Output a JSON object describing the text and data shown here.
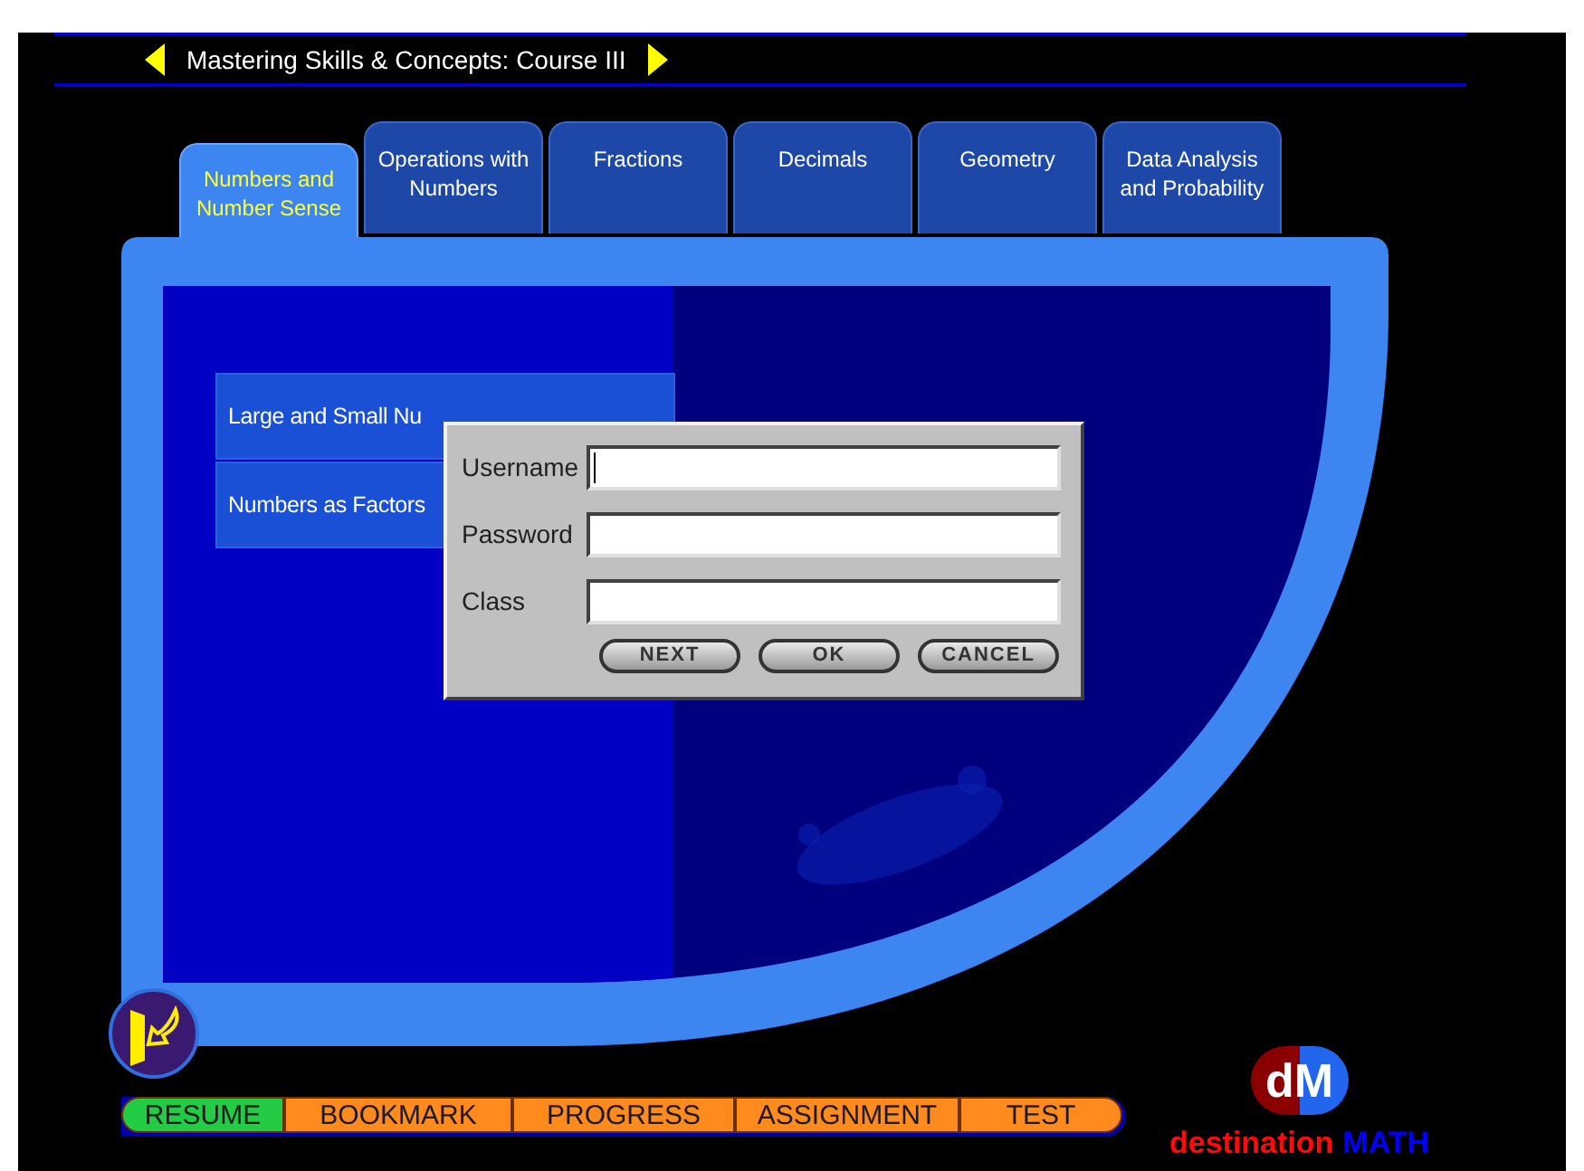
{
  "header": {
    "title": "Mastering Skills & Concepts: Course III"
  },
  "tabs": [
    {
      "label": "Numbers and Number Sense",
      "selected": true
    },
    {
      "label": "Operations with Numbers",
      "selected": false
    },
    {
      "label": "Fractions",
      "selected": false
    },
    {
      "label": "Decimals",
      "selected": false
    },
    {
      "label": "Geometry",
      "selected": false
    },
    {
      "label": "Data Analysis and Probability",
      "selected": false
    }
  ],
  "lessons": [
    {
      "label": "Large and Small Nu"
    },
    {
      "label": "Numbers as Factors"
    }
  ],
  "login_dialog": {
    "fields": [
      {
        "label": "Username",
        "focused": true
      },
      {
        "label": "Password",
        "focused": false
      },
      {
        "label": "Class",
        "focused": false
      }
    ],
    "buttons": [
      "NEXT",
      "OK",
      "CANCEL"
    ]
  },
  "nav_bar": [
    {
      "label": "RESUME",
      "color": "#22cc44"
    },
    {
      "label": "BOOKMARK",
      "color": "#ff8a1e"
    },
    {
      "label": "PROGRESS",
      "color": "#ff8a1e"
    },
    {
      "label": "ASSIGNMENT",
      "color": "#ff8a1e"
    },
    {
      "label": "TEST",
      "color": "#ff8a1e"
    }
  ],
  "brand": {
    "badge": "dM",
    "name": "destination",
    "suffix": "MATH"
  }
}
